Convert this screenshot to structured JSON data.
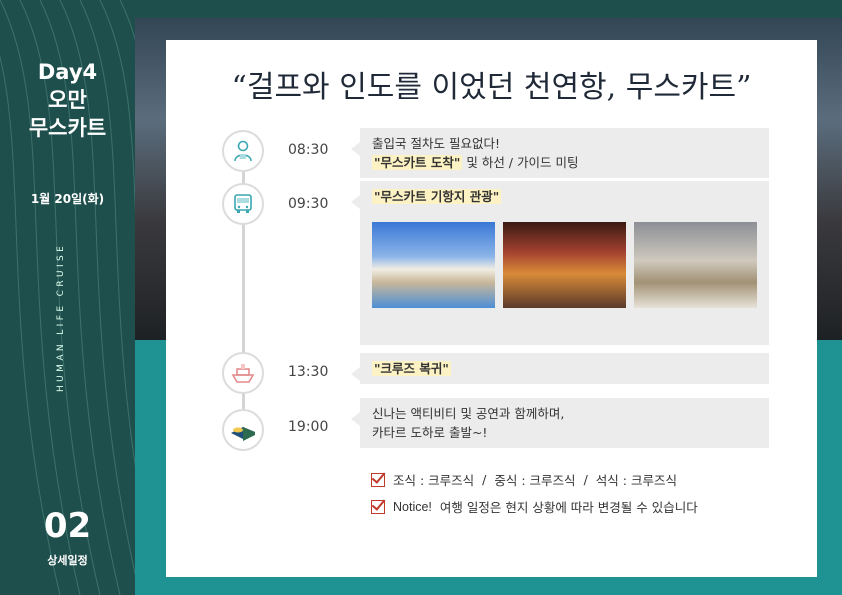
{
  "sidebar": {
    "day": "Day4",
    "country": "오만",
    "city": "무스카트",
    "date": "1월 20일(화)",
    "vertical_text": "HUMAN LIFE CRUISE",
    "section_number": "02",
    "section_label": "상세일정"
  },
  "card": {
    "title": "“걸프와 인도를 이었던 천연항, 무스카트”"
  },
  "schedule": [
    {
      "time": "08:30",
      "line1": "출입국 절차도 필요없다!",
      "highlight": "\"무스카트 도착\"",
      "line2_rest": " 및 하선 / 가이드 미팅",
      "icon": "passport-officer-icon"
    },
    {
      "time": "09:30",
      "highlight": "\"무스카트 기항지 관광\"",
      "icon": "bus-icon"
    },
    {
      "time": "13:30",
      "highlight": "\"크루즈 복귀\"",
      "icon": "cruise-ship-icon"
    },
    {
      "time": "19:00",
      "line1": "신나는 액티비티 및 공연과 함께하며,",
      "line2": "카타르 도하로 출발~!",
      "icon": "bed-icon"
    }
  ],
  "meals": {
    "breakfast": "조식 : 크루즈식",
    "sep1": "/",
    "lunch": "중식 : 크루즈식",
    "sep2": "/",
    "dinner": "석식 : 크루즈식"
  },
  "notice": {
    "label": "Notice!",
    "text": "여행 일정은 현지 상황에 따라 변경될 수 있습니다"
  },
  "colors": {
    "sidebar": "#1f4f4c",
    "teal": "#1f9393",
    "highlight": "#fdf2c4",
    "check": "#c0392b"
  }
}
